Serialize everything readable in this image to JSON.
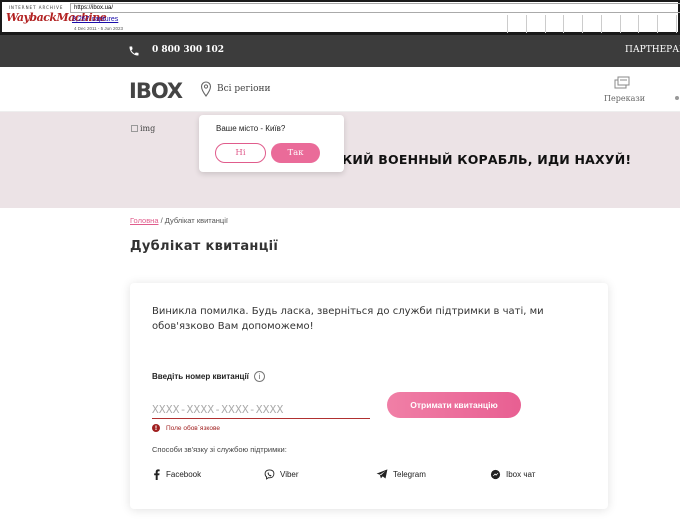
{
  "wayback": {
    "logo_top": "INTERNET ARCHIVE",
    "logo_main": "WaybackMachine",
    "url": "https://ibox.ua/",
    "captures": "3,267 captures",
    "range": "4 Dec 2011 - 5 Jun 2023"
  },
  "topbar": {
    "phone": "0 800 300 102",
    "partners": "ПАРТНЕРАМ"
  },
  "header": {
    "logo": "IBOX",
    "regions": "Всі регіони",
    "transfers": "Перекази"
  },
  "banner": {
    "img_alt": "img",
    "text": "КИЙ ВОЕННЫЙ КОРАБЛЬ, ИДИ НАХУЙ!"
  },
  "city_popup": {
    "question": "Ваше місто - Київ?",
    "no_label": "Ні",
    "yes_label": "Так"
  },
  "breadcrumb": {
    "home": "Головна",
    "separator": " / ",
    "current": "Дублікат квитанції"
  },
  "page_title": "Дублікат квитанції",
  "form": {
    "error_message": "Виникла помилка. Будь ласка, зверніться до служби підтримки в чаті, ми обов'язково Вам допоможемо!",
    "field_label": "Введіть номер квитанції",
    "info_glyph": "i",
    "input_placeholder": "XXXX-XXXX-XXXX-XXXX",
    "input_value": "",
    "required_msg": "Поле обов`язкове",
    "error_glyph": "!",
    "submit_label": "Отримати квитанцію",
    "contact_text": "Способи зв'язку зі службою підтримки:",
    "contacts": [
      {
        "label": "Facebook",
        "icon": "facebook-icon"
      },
      {
        "label": "Viber",
        "icon": "viber-icon"
      },
      {
        "label": "Telegram",
        "icon": "telegram-icon"
      },
      {
        "label": "Ibox чат",
        "icon": "chat-icon"
      }
    ]
  },
  "colors": {
    "accent": "#ea6b99",
    "banner_bg": "#ece3e6",
    "topbar_bg": "#3c3c3c",
    "error": "#a02020"
  }
}
